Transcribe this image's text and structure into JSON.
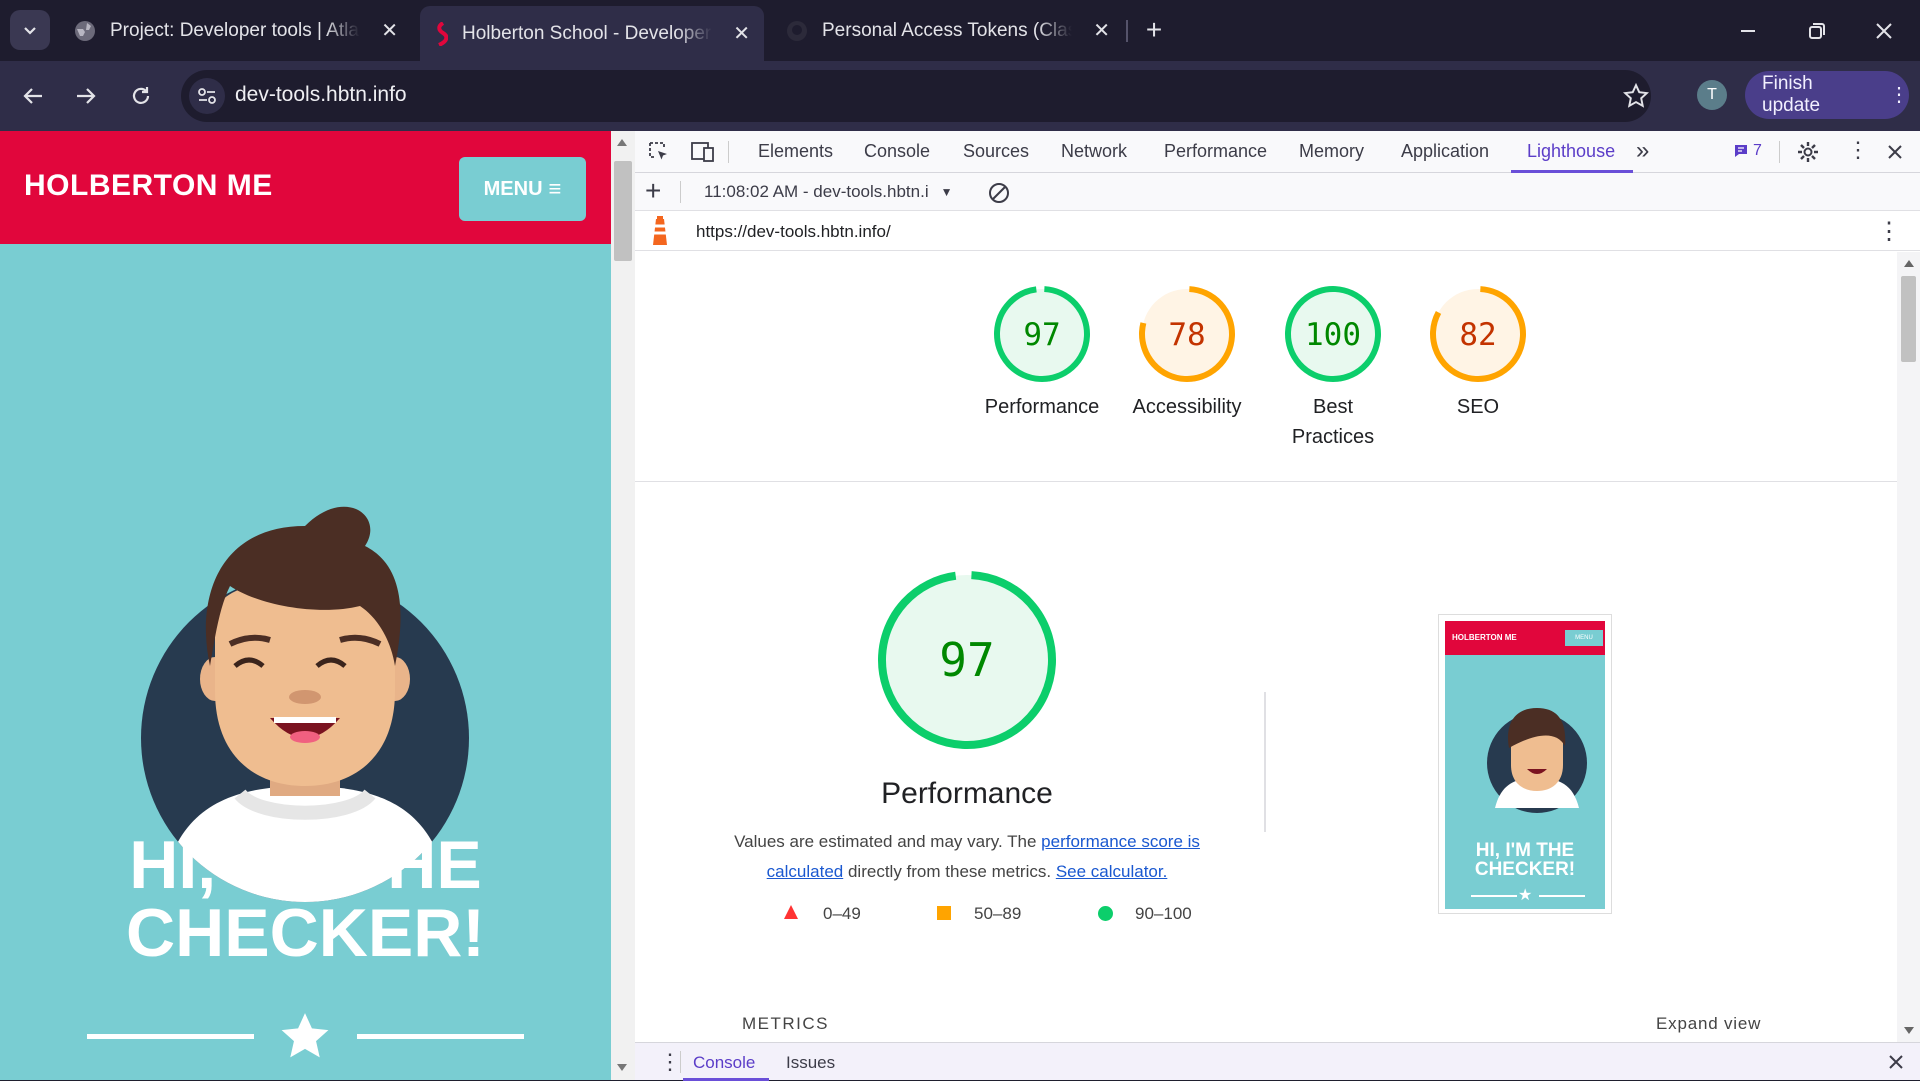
{
  "tabs": [
    {
      "title": "Project: Developer tools | Atlas",
      "icon": "globe-icon"
    },
    {
      "title": "Holberton School - Developer tools",
      "icon": "holberton-icon"
    },
    {
      "title": "Personal Access Tokens (Classic)",
      "icon": "github-icon"
    }
  ],
  "omnibar": {
    "url": "dev-tools.hbtn.info",
    "profile_initial": "T",
    "update_button": "Finish update"
  },
  "site": {
    "brand": "HOLBERTON ME",
    "menu_label": "MENU",
    "hero_line1": "HI, I'M THE",
    "hero_line2": "CHECKER!",
    "brand_color": "#e1063c",
    "bg_color": "#79cdd2"
  },
  "devtools": {
    "tabs": [
      "Elements",
      "Console",
      "Sources",
      "Network",
      "Performance",
      "Memory",
      "Application",
      "Lighthouse"
    ],
    "active_tab": "Lighthouse",
    "issues_count": "7",
    "report_selector": "11:08:02 AM - dev-tools.hbtn.i",
    "report_url": "https://dev-tools.hbtn.info/",
    "drawer_tabs": [
      "Console",
      "Issues"
    ]
  },
  "lighthouse": {
    "scores": [
      {
        "value": "97",
        "label": "Performance",
        "score": 0.97,
        "color": "#0cce6b"
      },
      {
        "value": "78",
        "label": "Accessibility",
        "score": 0.78,
        "color": "#ffa400"
      },
      {
        "value": "100",
        "label_line1": "Best",
        "label_line2": "Practices",
        "score": 1.0,
        "color": "#0cce6b"
      },
      {
        "value": "82",
        "label": "SEO",
        "score": 0.82,
        "color": "#ffa400"
      }
    ],
    "main_score": "97",
    "main_title": "Performance",
    "desc_part1": "Values are estimated and may vary. The",
    "desc_link1a": "performance score",
    "desc_link1b": "is calculated",
    "desc_part2": "directly from these metrics.",
    "desc_link2": "See calculator.",
    "legend": [
      "0–49",
      "50–89",
      "90–100"
    ],
    "metrics_heading": "METRICS",
    "expand_view": "Expand view",
    "thumb": {
      "brand": "HOLBERTON ME",
      "menu": "MENU",
      "line1": "HI, I'M THE",
      "line2": "CHECKER!"
    }
  }
}
